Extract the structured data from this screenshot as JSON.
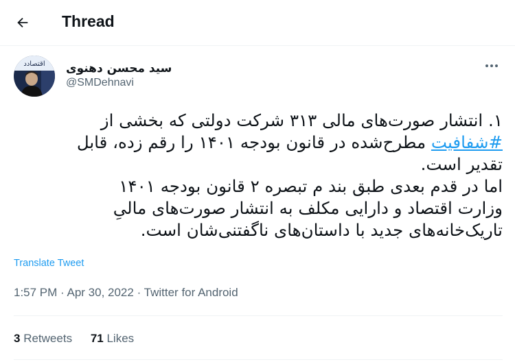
{
  "header": {
    "title": "Thread"
  },
  "author": {
    "display_name": "سید محسن دهنوی",
    "handle": "@SMDehnavi"
  },
  "tweet": {
    "line1": "۱. انتشار صورت‌های مالی ۳۱۳ شرکت دولتی که بخشی از",
    "hashtag": "#شفافیت",
    "line2_rest": " مطرح‌شده در قانون بودجه ۱۴۰۱ را رقم زده، قابل",
    "line3": "تقدیر است.",
    "line4": "اما در قدم بعدی طبق بند م تبصره ۲ قانون بودجه ۱۴۰۱",
    "line5": "وزارت اقتصاد و دارایی مکلف به انتشار صورت‌های مالیِ",
    "line6": "تاریک‌خانه‌های جدید با داستان‌های ناگفتنی‌شان است."
  },
  "translate_label": "Translate Tweet",
  "meta": {
    "time": "1:57 PM",
    "sep1": " · ",
    "date": "Apr 30, 2022",
    "sep2": " · ",
    "source": "Twitter for Android"
  },
  "stats": {
    "retweets_count": "3",
    "retweets_label": "Retweets",
    "likes_count": "71",
    "likes_label": "Likes"
  },
  "avatar_text": "اقتصادد",
  "icons": {
    "back": "arrow-left-icon",
    "more": "more-horizontal-icon"
  },
  "colors": {
    "accent": "#1d9bf0",
    "secondary_text": "#536471",
    "text": "#0f1419",
    "divider": "#eff3f4"
  }
}
